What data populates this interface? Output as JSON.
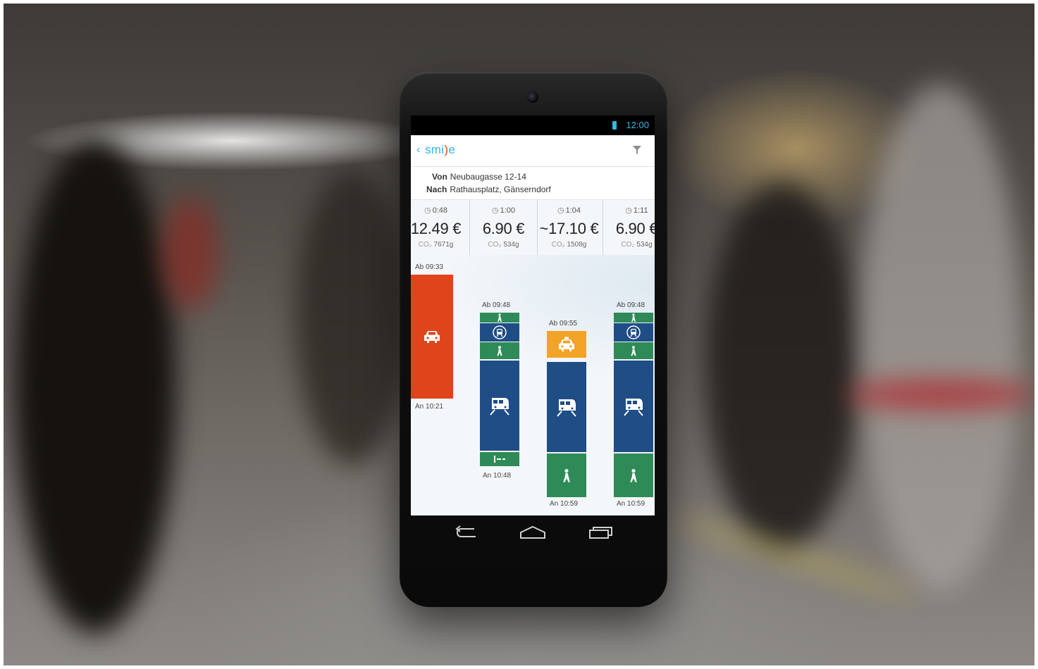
{
  "status_bar": {
    "time": "12:00",
    "battery_icon": "battery-icon"
  },
  "app": {
    "logo_text_left": "smi",
    "logo_text_mid": ")",
    "logo_text_right": "e",
    "back_icon": "back-chevron-icon",
    "filter_icon": "filter-icon",
    "accent_color": "#33b5e5"
  },
  "route": {
    "from_label": "Von",
    "from_value": "Neubaugasse 12-14",
    "to_label": "Nach",
    "to_value": "Rathausplatz, Gänserndorf"
  },
  "options": [
    {
      "duration": "0:48",
      "price": "12.49 €",
      "co2_label": "CO₂",
      "co2_value": "7671g",
      "depart": "Ab 09:33",
      "arrive": "An 10:21",
      "segments": [
        {
          "mode": "car",
          "icon": "car-icon",
          "color": "#e0441b"
        }
      ]
    },
    {
      "duration": "1:00",
      "price": "6.90 €",
      "co2_label": "CO₂",
      "co2_value": "534g",
      "depart": "Ab 09:48",
      "arrive": "An 10:48",
      "segments": [
        {
          "mode": "walk",
          "icon": "walk-icon",
          "color": "#2e8b57"
        },
        {
          "mode": "subway",
          "icon": "subway-icon",
          "color": "#1f4d86"
        },
        {
          "mode": "walk",
          "icon": "walk-icon",
          "color": "#2e8b57"
        },
        {
          "mode": "train",
          "icon": "train-icon",
          "color": "#1f4d86"
        },
        {
          "mode": "walk-transfer",
          "icon": "walk-transfer-icon",
          "color": "#2e8b57"
        }
      ]
    },
    {
      "duration": "1:04",
      "price": "~17.10 €",
      "co2_label": "CO₂",
      "co2_value": "1508g",
      "depart": "Ab 09:55",
      "arrive": "An 10:59",
      "segments": [
        {
          "mode": "taxi",
          "icon": "taxi-icon",
          "color": "#f3a325"
        },
        {
          "mode": "train",
          "icon": "train-icon",
          "color": "#1f4d86"
        },
        {
          "mode": "walk",
          "icon": "walk-icon",
          "color": "#2e8b57"
        }
      ]
    },
    {
      "duration": "1:11",
      "price": "6.90 €",
      "co2_label": "CO₂",
      "co2_value": "534g",
      "depart": "Ab 09:48",
      "arrive": "An 10:59",
      "segments": [
        {
          "mode": "walk",
          "icon": "walk-icon",
          "color": "#2e8b57"
        },
        {
          "mode": "subway",
          "icon": "subway-icon",
          "color": "#1f4d86"
        },
        {
          "mode": "walk",
          "icon": "walk-icon",
          "color": "#2e8b57"
        },
        {
          "mode": "train",
          "icon": "train-icon",
          "color": "#1f4d86"
        },
        {
          "mode": "walk",
          "icon": "walk-icon",
          "color": "#2e8b57"
        }
      ]
    }
  ],
  "nav_bar": {
    "back": "nav-back-icon",
    "home": "nav-home-icon",
    "recents": "nav-recents-icon"
  }
}
